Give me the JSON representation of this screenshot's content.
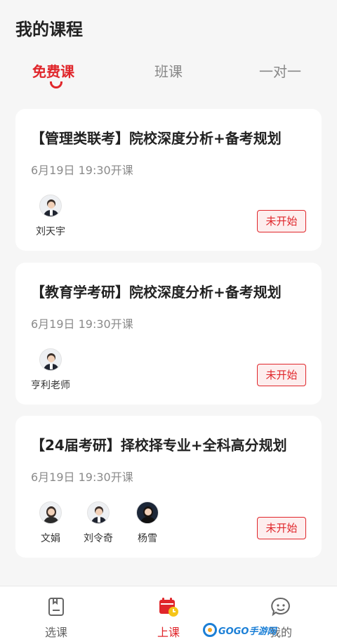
{
  "header": {
    "title": "我的课程"
  },
  "tabs": [
    {
      "label": "免费课",
      "active": true
    },
    {
      "label": "班课",
      "active": false
    },
    {
      "label": "一对一",
      "active": false
    }
  ],
  "courses": [
    {
      "title": "【管理类联考】院校深度分析+备考规划",
      "time": "6月19日 19:30开课",
      "teachers": [
        {
          "name": "刘天宇"
        }
      ],
      "status": "未开始"
    },
    {
      "title": "【教育学考研】院校深度分析+备考规划",
      "time": "6月19日 19:30开课",
      "teachers": [
        {
          "name": "亨利老师"
        }
      ],
      "status": "未开始"
    },
    {
      "title": "【24届考研】择校择专业+全科高分规划",
      "time": "6月19日 19:30开课",
      "teachers": [
        {
          "name": "文娟"
        },
        {
          "name": "刘令奇"
        },
        {
          "name": "杨雪"
        }
      ],
      "status": "未开始"
    }
  ],
  "bottom_nav": [
    {
      "label": "选课",
      "icon": "document-icon",
      "active": false
    },
    {
      "label": "上课",
      "icon": "calendar-clock-icon",
      "active": true
    },
    {
      "label": "我的",
      "icon": "chat-smile-icon",
      "active": false
    }
  ],
  "watermark": {
    "text": "GOGO手游网"
  },
  "colors": {
    "accent": "#e0262b",
    "background": "#f6f6f6"
  }
}
